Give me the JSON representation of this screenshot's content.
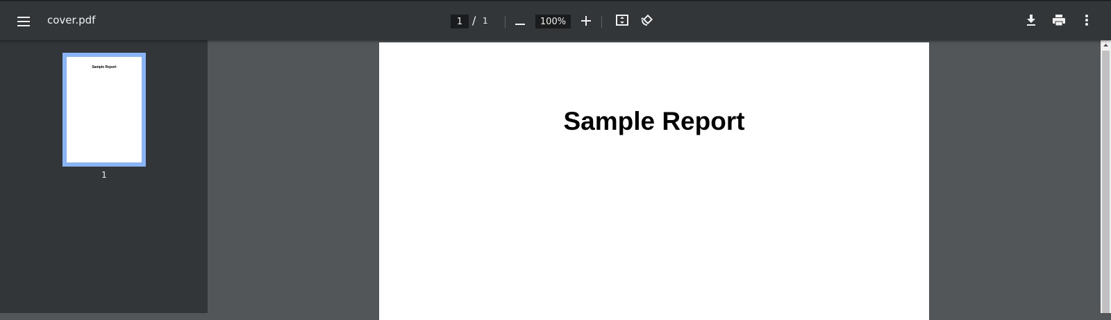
{
  "toolbar": {
    "menu_icon": "hamburger-menu-icon",
    "title": "cover.pdf",
    "page_current": "1",
    "page_separator": "/",
    "page_total": "1",
    "zoom_out_icon": "minus-icon",
    "zoom_value": "100%",
    "zoom_in_icon": "plus-icon",
    "fit_icon": "fit-to-page-icon",
    "rotate_icon": "rotate-counterclockwise-icon",
    "download_icon": "download-icon",
    "print_icon": "print-icon",
    "more_icon": "more-vert-icon"
  },
  "sidebar": {
    "thumbnails": [
      {
        "title": "Sample Report",
        "page_number": "1",
        "selected": true
      }
    ]
  },
  "document": {
    "heading": "Sample Report"
  },
  "colors": {
    "toolbar_bg": "#323639",
    "viewer_bg": "#525659",
    "thumbnail_selected_border": "#8ab4f8"
  }
}
